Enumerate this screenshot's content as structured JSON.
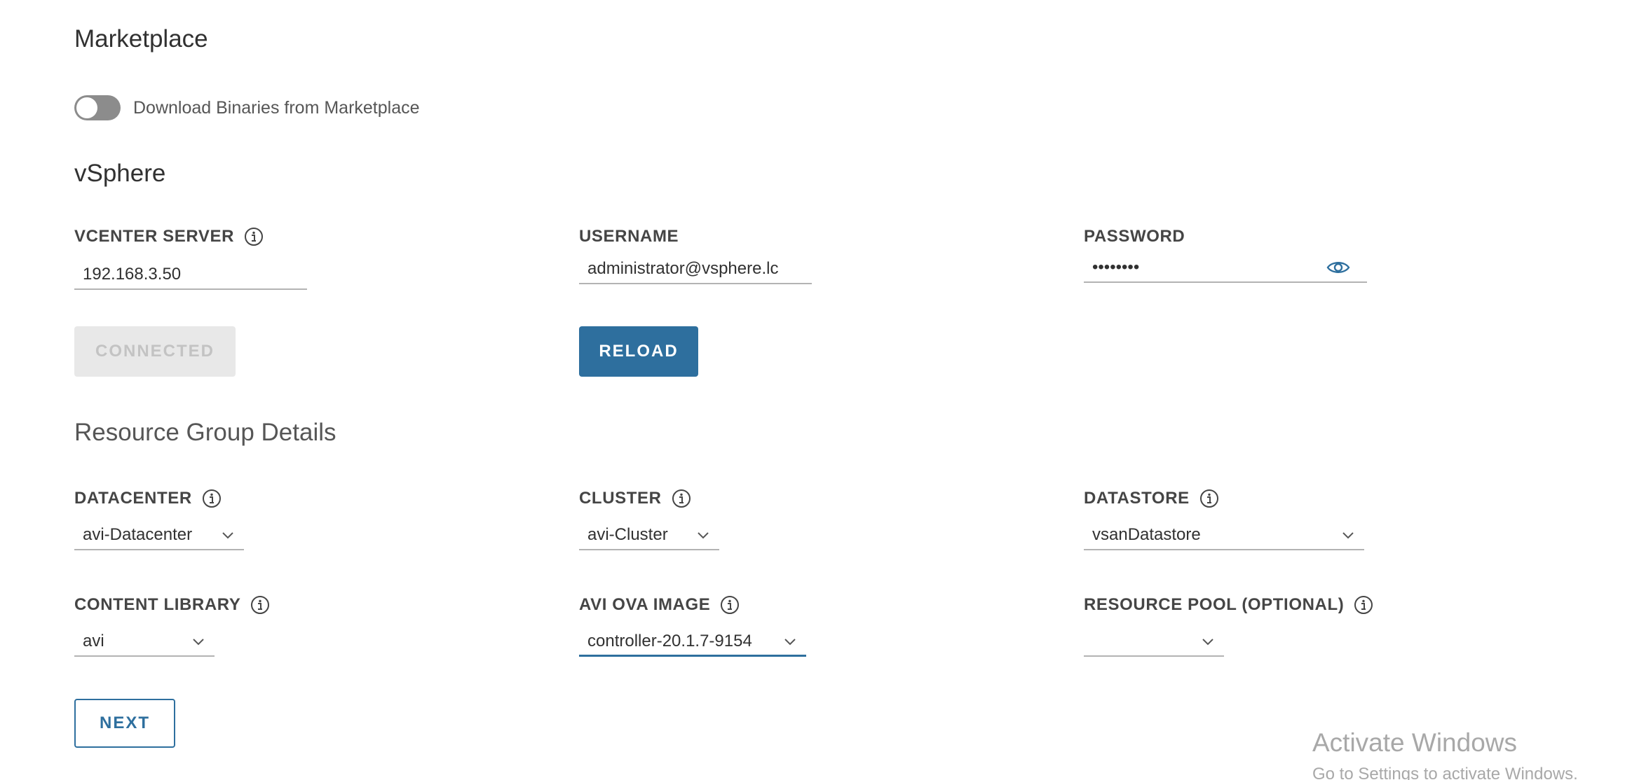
{
  "marketplace": {
    "title": "Marketplace",
    "toggle_label": "Download Binaries from Marketplace",
    "toggle_on": false
  },
  "vsphere": {
    "title": "vSphere",
    "vcenter": {
      "label": "VCENTER SERVER",
      "value": "192.168.3.50"
    },
    "username": {
      "label": "USERNAME",
      "value": "administrator@vsphere.lc"
    },
    "password": {
      "label": "PASSWORD",
      "value": "••••••••"
    },
    "connected_button": "CONNECTED",
    "reload_button": "RELOAD"
  },
  "resource_group": {
    "title": "Resource Group Details",
    "datacenter": {
      "label": "DATACENTER",
      "value": "avi-Datacenter"
    },
    "cluster": {
      "label": "CLUSTER",
      "value": "avi-Cluster"
    },
    "datastore": {
      "label": "DATASTORE",
      "value": "vsanDatastore"
    },
    "content_library": {
      "label": "CONTENT LIBRARY",
      "value": "avi"
    },
    "ova_image": {
      "label": "AVI OVA IMAGE",
      "value": "controller-20.1.7-9154"
    },
    "resource_pool": {
      "label": "RESOURCE POOL (OPTIONAL)",
      "value": ""
    }
  },
  "next_button": "NEXT",
  "watermark": {
    "title": "Activate Windows",
    "subtitle": "Go to Settings to activate Windows."
  },
  "colors": {
    "accent": "#2e6f9e",
    "text": "#313131",
    "disabled_bg": "#e8e8e8",
    "toggle_off": "#8c8c8c"
  }
}
